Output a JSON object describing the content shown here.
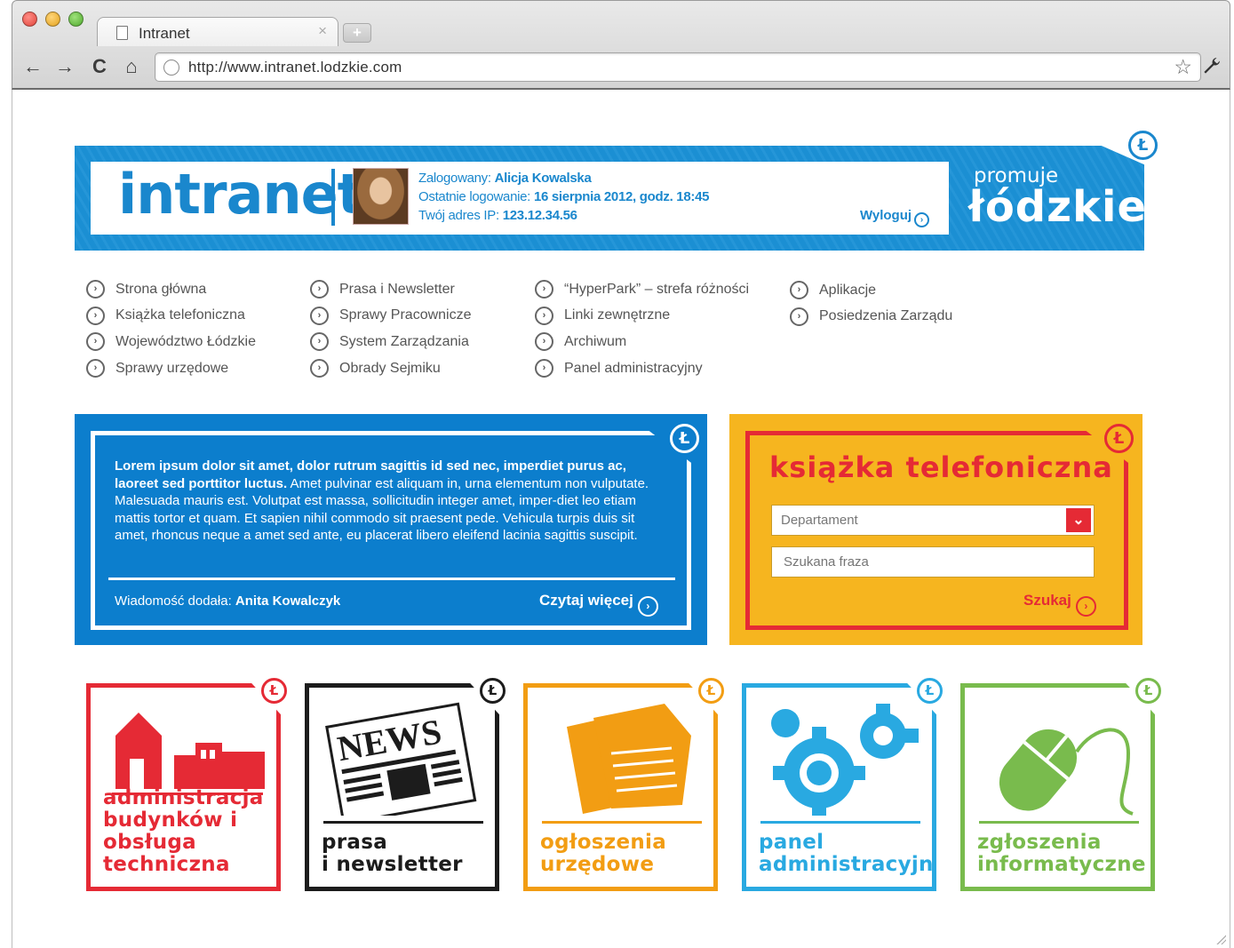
{
  "browser": {
    "tab_title": "Intranet",
    "tab_close": "×",
    "new_tab": "+",
    "url": "http://www.intranet.lodzkie.com",
    "back": "←",
    "forward": "→",
    "reload": "C",
    "home": "⌂",
    "star": "☆",
    "wrench": "🔧"
  },
  "header": {
    "logo": "intranet",
    "user_label": "Zalogowany:",
    "user_name": "Alicja Kowalska",
    "last_login_label": "Ostatnie logowanie:",
    "last_login_value": "16 sierpnia 2012, godz. 18:45",
    "ip_label": "Twój adres IP:",
    "ip_value": "123.12.34.56",
    "logout": "Wyloguj",
    "promuje": "promuje",
    "lodzkie": "łódzkie",
    "badge": "Ł"
  },
  "menu": {
    "columns": [
      [
        "Strona główna",
        "Książka telefoniczna",
        "Województwo Łódzkie",
        "Sprawy urzędowe"
      ],
      [
        "Prasa i Newsletter",
        "Sprawy Pracownicze",
        "System Zarządzania",
        "Obrady Sejmiku"
      ],
      [
        "“HyperPark” – strefa różności",
        "Linki zewnętrzne",
        "Archiwum",
        "Panel administracyjny"
      ],
      [
        "Aplikacje",
        "Posiedzenia Zarządu"
      ]
    ],
    "arrow": "›"
  },
  "news": {
    "text_bold": "Lorem ipsum dolor sit amet, dolor rutrum sagittis id sed nec, imperdiet purus ac, laoreet sed porttitor luctus.",
    "text_rest": " Amet pulvinar est aliquam in, urna elementum non vulputate. Malesuada mauris est. Volutpat est massa, sollicitudin integer amet, imper-diet leo etiam mattis tortor et quam. Et sapien nihil commodo sit praesent pede. Vehicula turpis duis sit amet, rhoncus neque a amet sed ante, eu placerat libero eleifend lacinia sagittis suscipit.",
    "author_label": "Wiadomość dodała:",
    "author_name": "Anita Kowalczyk",
    "read_more": "Czytaj więcej"
  },
  "phonebook": {
    "title": "książka telefoniczna",
    "department_value": "Departament",
    "search_placeholder": "Szukana fraza",
    "search_button": "Szukaj"
  },
  "tiles": [
    {
      "line1": "administracja",
      "line2": "budynków i",
      "line3": "obsługa",
      "line4": "techniczna",
      "color": "#e52a35"
    },
    {
      "line1": "prasa",
      "line2": "i newsletter",
      "color": "#1c1c1c",
      "news_word": "NEWS"
    },
    {
      "line1": "ogłoszenia",
      "line2": "urzędowe",
      "color": "#f29d13"
    },
    {
      "line1": "panel",
      "line2": "administracyjny",
      "color": "#29a9e1"
    },
    {
      "line1": "zgłoszenia",
      "line2": "informatyczne",
      "color": "#79bb4d"
    }
  ],
  "colors": {
    "blue": "#1a87cd",
    "news_blue": "#0c7ecd",
    "yellow": "#f6b51f",
    "red": "#e52a35"
  }
}
